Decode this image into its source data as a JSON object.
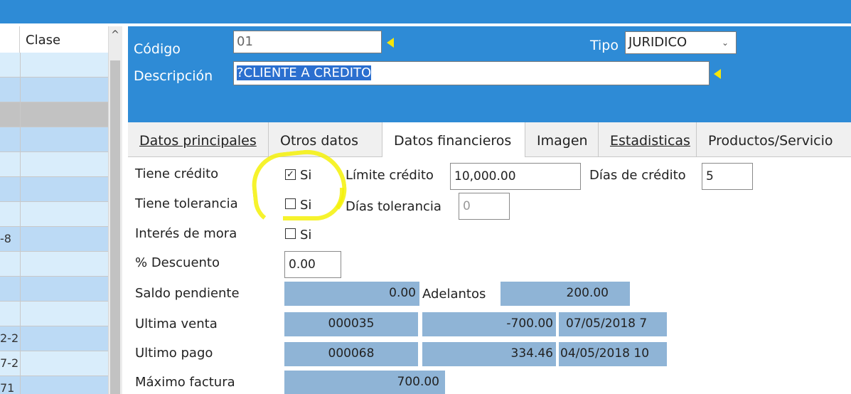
{
  "grid": {
    "header_label": "Clase",
    "scroll_up_glyph": "^",
    "rows": [
      {
        "text": "",
        "bg": "#d9edfb"
      },
      {
        "text": "",
        "bg": "#bcdaf5"
      },
      {
        "text": "",
        "bg": "#c2c2c2"
      },
      {
        "text": "",
        "bg": "#bcdaf5"
      },
      {
        "text": "",
        "bg": "#d9edfb"
      },
      {
        "text": "",
        "bg": "#bcdaf5"
      },
      {
        "text": "",
        "bg": "#d9edfb"
      },
      {
        "text": "-8",
        "bg": "#bcdaf5"
      },
      {
        "text": "",
        "bg": "#d9edfb"
      },
      {
        "text": "",
        "bg": "#bcdaf5"
      },
      {
        "text": "",
        "bg": "#d9edfb"
      },
      {
        "text": "2-2",
        "bg": "#bcdaf5"
      },
      {
        "text": "7-2",
        "bg": "#d9edfb"
      },
      {
        "text": "71",
        "bg": "#bcdaf5"
      }
    ]
  },
  "header": {
    "codigo_label": "Código",
    "codigo_value": "01",
    "tipo_label": "Tipo",
    "tipo_value": "JURIDICO",
    "descripcion_label": "Descripción",
    "descripcion_value": "?CLIENTE A CREDITO"
  },
  "tabs": [
    {
      "label": "Datos principales"
    },
    {
      "label": "Otros datos"
    },
    {
      "label": "Datos financieros"
    },
    {
      "label": "Imagen"
    },
    {
      "label": "Estadisticas"
    },
    {
      "label": "Productos/Servicio"
    }
  ],
  "form": {
    "tiene_credito_label": "Tiene crédito",
    "tiene_credito_si": "Si",
    "tiene_credito_checked": true,
    "limite_credito_label": "Límite crédito",
    "limite_credito_value": "10,000.00",
    "dias_credito_label": "Días de crédito",
    "dias_credito_value": "5",
    "tiene_tolerancia_label": "Tiene tolerancia",
    "tiene_tolerancia_si": "Si",
    "dias_tolerancia_label": "Días tolerancia",
    "dias_tolerancia_value": "0",
    "interes_mora_label": "Interés de mora",
    "interes_mora_si": "Si",
    "descuento_label": "% Descuento",
    "descuento_value": "0.00",
    "saldo_pendiente_label": "Saldo pendiente",
    "saldo_pendiente_value": "0.00",
    "adelantos_label": "Adelantos",
    "adelantos_value": "200.00",
    "ultima_venta_label": "Ultima venta",
    "ultima_venta_doc": "000035",
    "ultima_venta_monto": "-700.00",
    "ultima_venta_fecha": "07/05/2018 7",
    "ultimo_pago_label": "Ultimo pago",
    "ultimo_pago_doc": "000068",
    "ultimo_pago_monto": "334.46",
    "ultimo_pago_fecha": "04/05/2018 10",
    "maximo_factura_label": "Máximo factura",
    "maximo_factura_value": "700.00"
  },
  "colors": {
    "header_blue": "#2e8bd6",
    "readonly_blue": "#8fb4d6",
    "arrow_yellow": "#f5e50a",
    "highlight_yellow": "#f5f209"
  }
}
